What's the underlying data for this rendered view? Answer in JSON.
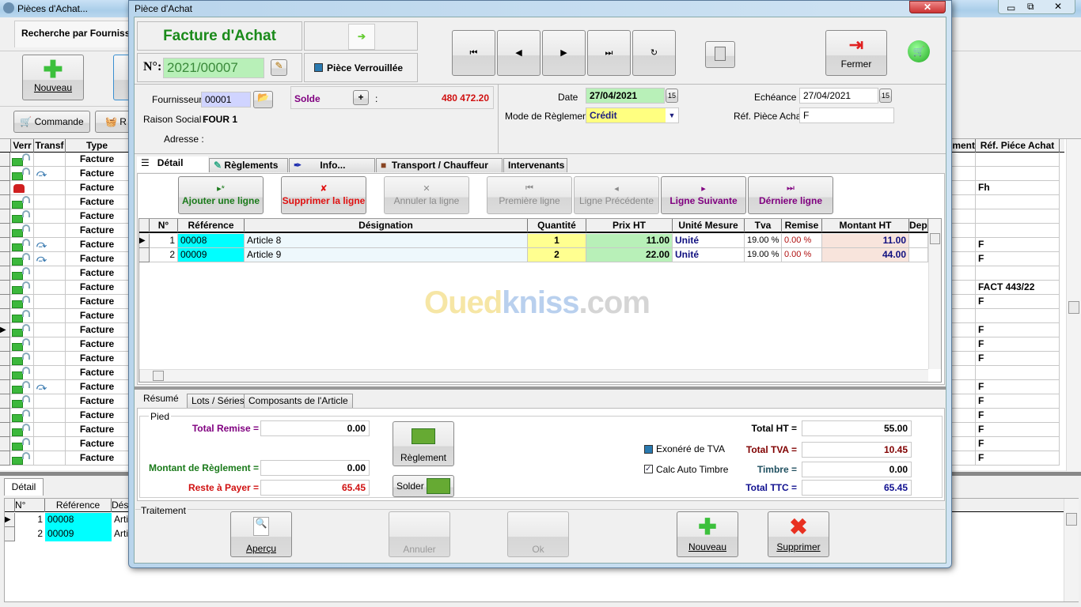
{
  "bg_window": {
    "title": "Pièces d'Achat...",
    "search_tab": "Recherche par Fournisseur",
    "new_button": "Nouveau",
    "commande_button": "Commande",
    "second_button": "R",
    "grid_headers": [
      "Verr",
      "Transf",
      "Type"
    ],
    "right_headers": [
      "ment",
      "Réf. Piéce Achat"
    ],
    "rows": [
      {
        "type": "Facture",
        "locked": false,
        "transf": false,
        "ref": ""
      },
      {
        "type": "Facture",
        "locked": false,
        "transf": true,
        "ref": ""
      },
      {
        "type": "Facture",
        "locked": true,
        "transf": false,
        "ref": "Fh"
      },
      {
        "type": "Facture",
        "locked": false,
        "transf": false,
        "ref": ""
      },
      {
        "type": "Facture",
        "locked": false,
        "transf": false,
        "ref": ""
      },
      {
        "type": "Facture",
        "locked": false,
        "transf": false,
        "ref": ""
      },
      {
        "type": "Facture",
        "locked": false,
        "transf": true,
        "ref": "F"
      },
      {
        "type": "Facture",
        "locked": false,
        "transf": true,
        "ref": "F"
      },
      {
        "type": "Facture",
        "locked": false,
        "transf": false,
        "ref": ""
      },
      {
        "type": "Facture",
        "locked": false,
        "transf": false,
        "ref": "FACT 443/22"
      },
      {
        "type": "Facture",
        "locked": false,
        "transf": false,
        "ref": "F"
      },
      {
        "type": "Facture",
        "locked": false,
        "transf": false,
        "ref": ""
      },
      {
        "type": "Facture",
        "locked": false,
        "transf": false,
        "ref": "F",
        "selected": true
      },
      {
        "type": "Facture",
        "locked": false,
        "transf": false,
        "ref": "F"
      },
      {
        "type": "Facture",
        "locked": false,
        "transf": false,
        "ref": "F"
      },
      {
        "type": "Facture",
        "locked": false,
        "transf": false,
        "ref": ""
      },
      {
        "type": "Facture",
        "locked": false,
        "transf": true,
        "ref": "F"
      },
      {
        "type": "Facture",
        "locked": false,
        "transf": false,
        "ref": "F"
      },
      {
        "type": "Facture",
        "locked": false,
        "transf": false,
        "ref": "F"
      },
      {
        "type": "Facture",
        "locked": false,
        "transf": false,
        "ref": "F"
      },
      {
        "type": "Facture",
        "locked": false,
        "transf": false,
        "ref": "F"
      },
      {
        "type": "Facture",
        "locked": false,
        "transf": false,
        "ref": "F"
      }
    ],
    "detail_tab": "Détail",
    "detail_headers": [
      "N°",
      "Référence",
      "Dés"
    ],
    "detail_rows": [
      {
        "n": "1",
        "ref": "00008",
        "des": "Artic"
      },
      {
        "n": "2",
        "ref": "00009",
        "des": "Artic"
      }
    ]
  },
  "dialog": {
    "title": "Pièce d'Achat",
    "doc_type": "Facture d'Achat",
    "number_label": "N°:",
    "number": "2021/00007",
    "locked_label": "Pièce Verrouillée",
    "fermer": "Fermer",
    "fournisseur_label": "Fournisseur :",
    "fournisseur": "00001",
    "solde_label": "Solde",
    "solde_plus": "+",
    "solde_colon": ":",
    "solde": "480 472.20",
    "raison_label": "Raison Social :",
    "raison": "FOUR 1",
    "adresse_label": "Adresse :",
    "date_label": "Date",
    "date": "27/04/2021",
    "mode_label": "Mode de Règlement",
    "mode": "Crédit",
    "echeance_label": "Echéance",
    "echeance": "27/04/2021",
    "ref_label": "Réf. Pièce Achat",
    "ref": "F",
    "cal_icon_text": "15",
    "tabs": [
      "Détail",
      "Règlements",
      "Info...",
      "Transport / Chauffeur",
      "Intervenants"
    ],
    "line_buttons": [
      {
        "label": "Ajouter une ligne",
        "icon": "▸*",
        "color": "#1a7a1a",
        "enabled": true
      },
      {
        "label": "Supprimer la ligne",
        "icon": "✘",
        "color": "#e01010",
        "enabled": true
      },
      {
        "label": "Annuler la ligne",
        "icon": "✕",
        "color": "#8a8a8a",
        "enabled": false
      },
      {
        "label": "Première ligne",
        "icon": "⏮",
        "color": "#8a8a8a",
        "enabled": false
      },
      {
        "label": "Ligne Précédente",
        "icon": "◂",
        "color": "#8a8a8a",
        "enabled": false
      },
      {
        "label": "Ligne Suivante",
        "icon": "▸",
        "color": "#800080",
        "enabled": true
      },
      {
        "label": "Dérniere ligne",
        "icon": "⏭",
        "color": "#800080",
        "enabled": true
      }
    ],
    "lines_headers": [
      "N°",
      "Référence",
      "Désignation",
      "Quantité",
      "Prix HT",
      "Unité Mesure",
      "Tva",
      "Remise",
      "Montant HT",
      "Depo"
    ],
    "lines": [
      {
        "n": "1",
        "ref": "00008",
        "des": "Article 8",
        "qte": "1",
        "prix": "11.00",
        "unite": "Unité",
        "tva": "19.00 %",
        "remise": "0.00 %",
        "montant": "11.00"
      },
      {
        "n": "2",
        "ref": "00009",
        "des": "Article 9",
        "qte": "2",
        "prix": "22.00",
        "unite": "Unité",
        "tva": "19.00 %",
        "remise": "0.00 %",
        "montant": "44.00"
      }
    ],
    "watermark": {
      "part1": "Oued",
      "part2": "kniss",
      "part3": ".com"
    },
    "bottom_tabs": [
      "Résumé",
      "Lots / Séries",
      "Composants de l'Article"
    ],
    "pied_label": "Pied",
    "total_remise_label": "Total Remise =",
    "total_remise": "0.00",
    "montant_reglement_label": "Montant de Règlement =",
    "montant_reglement": "0.00",
    "reste_label": "Reste à Payer =",
    "reste": "65.45",
    "reglement_button": "Règlement",
    "solder_button": "Solder",
    "exonere_label": "Exonéré de TVA",
    "exonere": false,
    "timbre_auto_label": "Calc Auto Timbre",
    "timbre_auto": true,
    "total_ht_label": "Total HT =",
    "total_ht": "55.00",
    "total_tva_label": "Total TVA =",
    "total_tva": "10.45",
    "timbre_label": "Timbre =",
    "timbre": "0.00",
    "total_ttc_label": "Total TTC =",
    "total_ttc": "65.45",
    "traitement_label": "Traitement",
    "apercu": "Aperçu",
    "annuler": "Annuler",
    "ok": "Ok",
    "nouveau": "Nouveau",
    "supprimer": "Supprimer"
  },
  "colors": {
    "title_green": "#1a8a1a",
    "solde_red": "#d01010",
    "purple": "#800080",
    "cyan": "#00ffff"
  }
}
